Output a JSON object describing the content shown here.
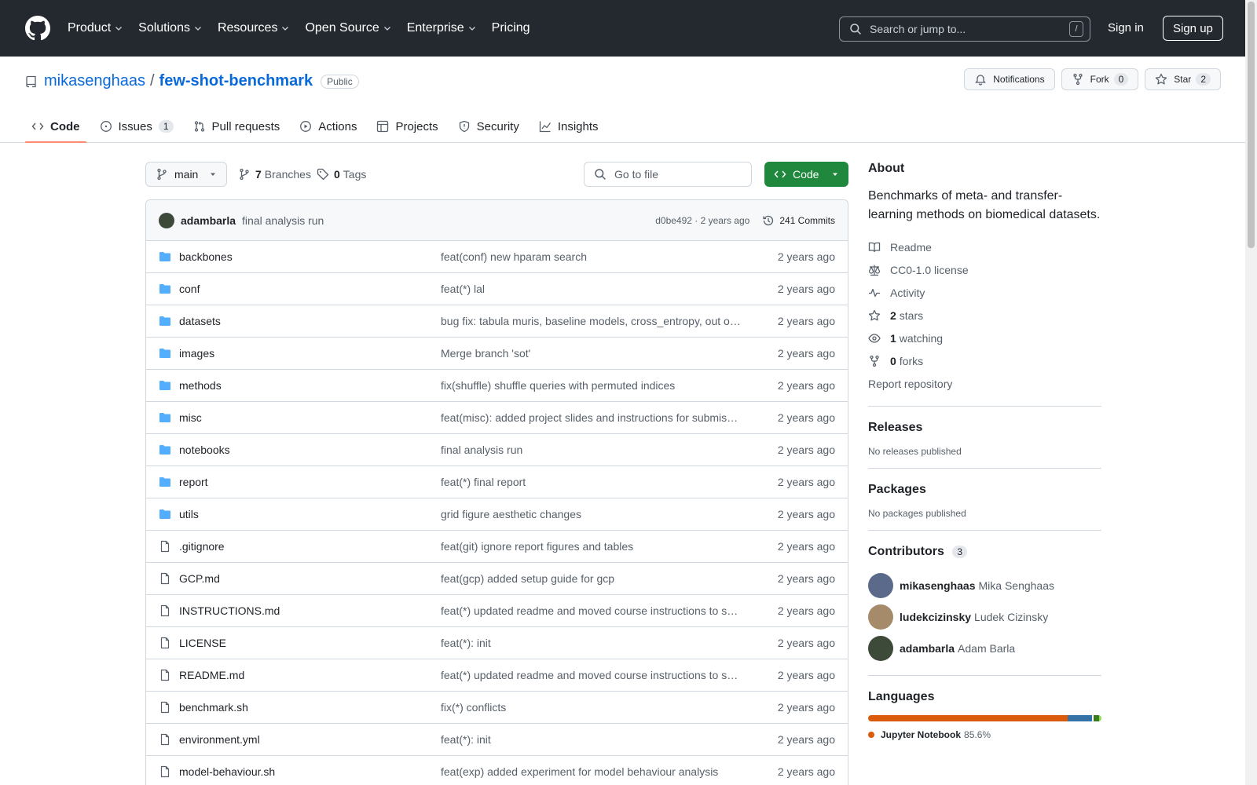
{
  "header": {
    "nav": [
      "Product",
      "Solutions",
      "Resources",
      "Open Source",
      "Enterprise",
      "Pricing"
    ],
    "search_placeholder": "Search or jump to...",
    "search_key": "/",
    "signin": "Sign in",
    "signup": "Sign up"
  },
  "repo": {
    "owner": "mikasenghaas",
    "separator": "/",
    "name": "few-shot-benchmark",
    "visibility": "Public",
    "notifications": "Notifications",
    "fork_label": "Fork",
    "fork_count": "0",
    "star_label": "Star",
    "star_count": "2"
  },
  "tabs": [
    {
      "label": "Code",
      "icon": "code-icon",
      "active": true
    },
    {
      "label": "Issues",
      "icon": "issue-icon",
      "count": "1"
    },
    {
      "label": "Pull requests",
      "icon": "pull-request-icon"
    },
    {
      "label": "Actions",
      "icon": "play-icon"
    },
    {
      "label": "Projects",
      "icon": "table-icon"
    },
    {
      "label": "Security",
      "icon": "shield-icon"
    },
    {
      "label": "Insights",
      "icon": "graph-icon"
    }
  ],
  "toolbar": {
    "branch": "main",
    "branches_count": "7",
    "branches_label": "Branches",
    "tags_count": "0",
    "tags_label": "Tags",
    "goto_placeholder": "Go to file",
    "code_label": "Code"
  },
  "commit": {
    "author": "adambarla",
    "message": "final analysis run",
    "meta": "d0be492 · 2 years ago",
    "count": "241 Commits"
  },
  "files": [
    {
      "type": "dir",
      "name": "backbones",
      "message": "feat(conf) new hparam search",
      "date": "2 years ago"
    },
    {
      "type": "dir",
      "name": "conf",
      "message": "feat(*) lal",
      "date": "2 years ago"
    },
    {
      "type": "dir",
      "name": "datasets",
      "message": "bug fix: tabula muris, baseline models, cross_entropy, out o…",
      "date": "2 years ago"
    },
    {
      "type": "dir",
      "name": "images",
      "message": "Merge branch 'sot'",
      "date": "2 years ago"
    },
    {
      "type": "dir",
      "name": "methods",
      "message": "fix(shuffle) shuffle queries with permuted indices",
      "date": "2 years ago"
    },
    {
      "type": "dir",
      "name": "misc",
      "message": "feat(misc): added project slides and instructions for submis…",
      "date": "2 years ago"
    },
    {
      "type": "dir",
      "name": "notebooks",
      "message": "final analysis run",
      "date": "2 years ago"
    },
    {
      "type": "dir",
      "name": "report",
      "message": "feat(*) final report",
      "date": "2 years ago"
    },
    {
      "type": "dir",
      "name": "utils",
      "message": "grid figure aesthetic changes",
      "date": "2 years ago"
    },
    {
      "type": "file",
      "name": ".gitignore",
      "message": "feat(git) ignore report figures and tables",
      "date": "2 years ago"
    },
    {
      "type": "file",
      "name": "GCP.md",
      "message": "feat(gcp) added setup guide for gcp",
      "date": "2 years ago"
    },
    {
      "type": "file",
      "name": "INSTRUCTIONS.md",
      "message": "feat(*) updated readme and moved course instructions to s…",
      "date": "2 years ago"
    },
    {
      "type": "file",
      "name": "LICENSE",
      "message": "feat(*): init",
      "date": "2 years ago"
    },
    {
      "type": "file",
      "name": "README.md",
      "message": "feat(*) updated readme and moved course instructions to s…",
      "date": "2 years ago"
    },
    {
      "type": "file",
      "name": "benchmark.sh",
      "message": "fix(*) conflicts",
      "date": "2 years ago"
    },
    {
      "type": "file",
      "name": "environment.yml",
      "message": "feat(*): init",
      "date": "2 years ago"
    },
    {
      "type": "file",
      "name": "model-behaviour.sh",
      "message": "feat(exp) added experiment for model behaviour analysis",
      "date": "2 years ago"
    }
  ],
  "about": {
    "title": "About",
    "description": "Benchmarks of meta- and transfer-learning methods on biomedical datasets.",
    "readme": "Readme",
    "license": "CC0-1.0 license",
    "activity": "Activity",
    "stars_count": "2",
    "stars_label": "stars",
    "watching_count": "1",
    "watching_label": "watching",
    "forks_count": "0",
    "forks_label": "forks",
    "report": "Report repository"
  },
  "releases": {
    "title": "Releases",
    "note": "No releases published"
  },
  "packages": {
    "title": "Packages",
    "note": "No packages published"
  },
  "contributors": {
    "title": "Contributors",
    "count": "3",
    "people": [
      {
        "login": "mikasenghaas",
        "name": "Mika Senghaas",
        "color": "#5b6a8a"
      },
      {
        "login": "ludekcizinsky",
        "name": "Ludek Cizinsky",
        "color": "#a58b6a"
      },
      {
        "login": "adambarla",
        "name": "Adam Barla",
        "color": "#3d4a3a"
      }
    ]
  },
  "languages": {
    "title": "Languages",
    "bar": [
      {
        "color": "#DA5B0B",
        "percent": 85.6
      },
      {
        "color": "#3572A5",
        "percent": 10.5
      },
      {
        "color": "#ffffff",
        "percent": 0.4
      },
      {
        "color": "#3c7a1e",
        "percent": 2.5
      },
      {
        "color": "#89e051",
        "percent": 1.0
      }
    ],
    "top_name": "Jupyter Notebook",
    "top_percent": "85.6%",
    "top_color": "#DA5B0B"
  },
  "colors": {
    "header_bg": "#24292f",
    "accent": "#0969da",
    "green": "#1f883d",
    "tab_underline": "#fd8c73",
    "folder": "#54aeff"
  }
}
